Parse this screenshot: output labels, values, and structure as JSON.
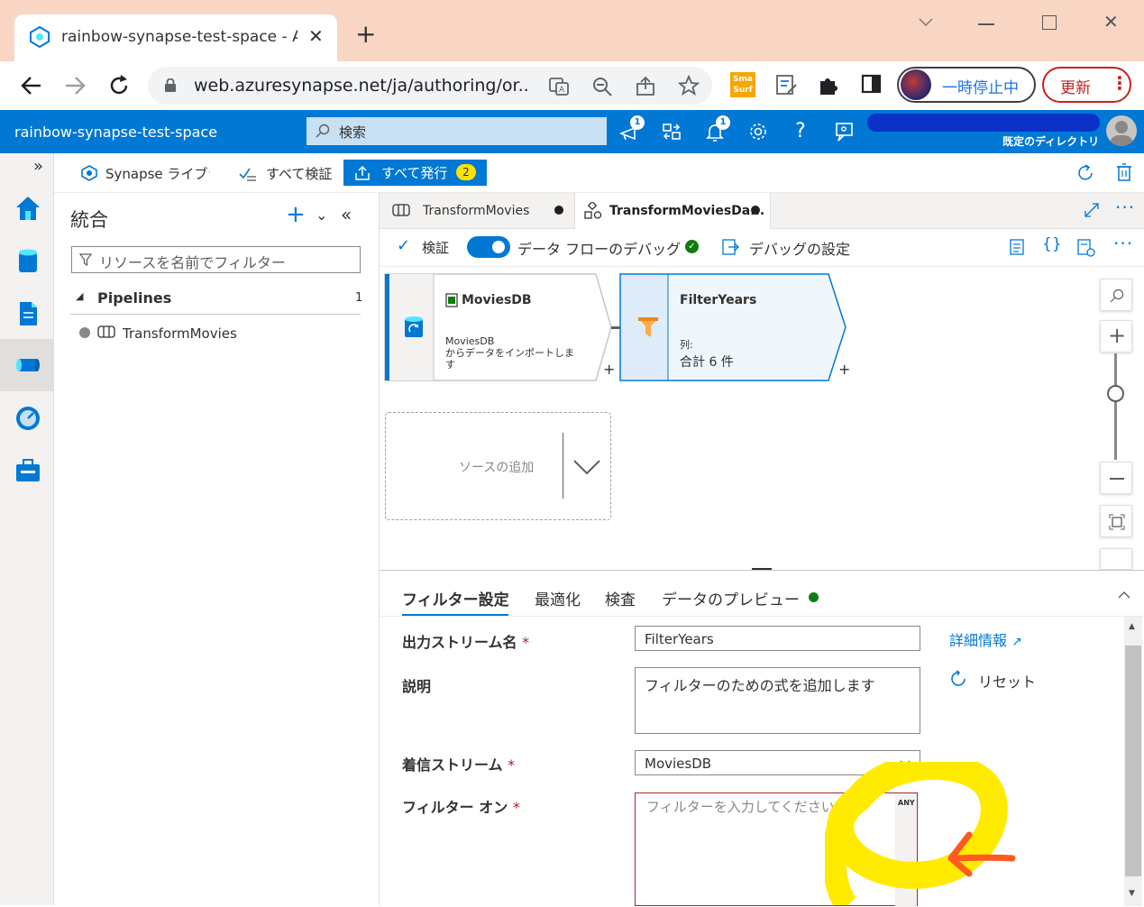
{
  "browser": {
    "tab_title": "rainbow-synapse-test-space - Azure",
    "new_tab": "+",
    "url": "web.azuresynapse.net/ja/authoring/or...",
    "profile_label": "一時停止中",
    "update_label": "更新"
  },
  "header": {
    "workspace": "rainbow-synapse-test-space",
    "search_placeholder": "検索",
    "notification_count_1": "1",
    "notification_count_2": "1",
    "directory": "既定のディレクトリ"
  },
  "toolbar": {
    "library_label": "Synapse ライブラリ",
    "validate_all": "すべて検証",
    "publish_all": "すべて発行",
    "publish_count": "2"
  },
  "resources": {
    "title": "統合",
    "filter_placeholder": "リソースを名前でフィルター",
    "section": "Pipelines",
    "section_count": "1",
    "items": [
      {
        "label": "TransformMovies"
      }
    ]
  },
  "tabs": [
    {
      "label": "TransformMovies"
    },
    {
      "label": "TransformMoviesDa..."
    }
  ],
  "command_bar": {
    "validate": "検証",
    "debug_label": "データ フローのデバッグ",
    "debug_settings": "デバッグの設定"
  },
  "canvas": {
    "source_node": {
      "title": "MoviesDB",
      "line1": "MoviesDB",
      "line2": "からデータをインポートしま",
      "line3": "す"
    },
    "filter_node": {
      "title": "FilterYears",
      "line1": "列:",
      "line2": "合計 6 件"
    },
    "add_source": "ソースの追加",
    "plus": "+"
  },
  "settings": {
    "tabs": [
      "フィルター設定",
      "最適化",
      "検査",
      "データのプレビュー"
    ],
    "output_stream_label": "出力ストリーム名",
    "output_stream_value": "FilterYears",
    "description_label": "説明",
    "description_value": "フィルターのための式を追加します",
    "incoming_label": "着信ストリーム",
    "incoming_value": "MoviesDB",
    "filter_on_label": "フィルター オン",
    "filter_placeholder": "フィルターを入力してください...",
    "any_badge": "ANY",
    "details_link": "詳細情報",
    "reset": "リセット",
    "required_mark": "*"
  },
  "colors": {
    "azure_blue": "#0078d4",
    "chrome_frame": "#f9d6c4",
    "highlight_yellow": "#ffeb00",
    "arrow_orange": "#ff5a1f",
    "status_green": "#107c10"
  }
}
